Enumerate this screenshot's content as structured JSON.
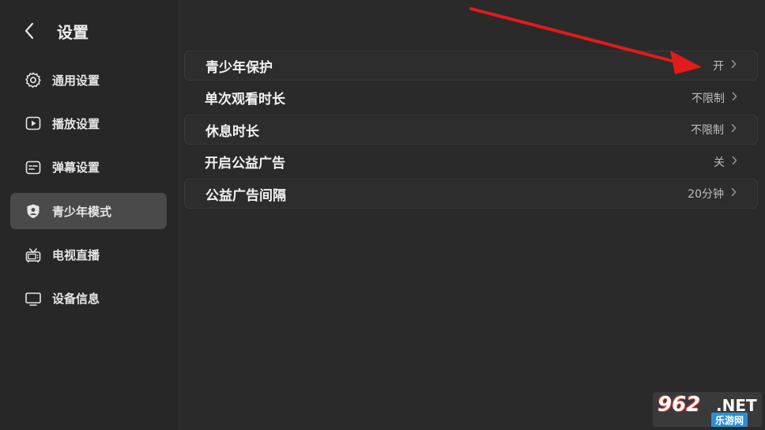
{
  "header": {
    "title": "设置"
  },
  "sidebar": {
    "items": [
      {
        "label": "通用设置",
        "icon": "gear-icon",
        "active": false
      },
      {
        "label": "播放设置",
        "icon": "play-icon",
        "active": false
      },
      {
        "label": "弹幕设置",
        "icon": "danmaku-icon",
        "active": false
      },
      {
        "label": "青少年模式",
        "icon": "shield-user-icon",
        "active": true
      },
      {
        "label": "电视直播",
        "icon": "tv-antenna-icon",
        "active": false
      },
      {
        "label": "设备信息",
        "icon": "monitor-icon",
        "active": false
      }
    ]
  },
  "settings": {
    "rows": [
      {
        "label": "青少年保护",
        "value": "开"
      },
      {
        "label": "单次观看时长",
        "value": "不限制"
      },
      {
        "label": "休息时长",
        "value": "不限制"
      },
      {
        "label": "开启公益广告",
        "value": "关"
      },
      {
        "label": "公益广告间隔",
        "value": "20分钟"
      }
    ]
  },
  "annotation": {
    "color": "#e21b1b"
  },
  "watermark": {
    "number": "962",
    "suffix": ".NET",
    "subtitle": "乐游网"
  }
}
